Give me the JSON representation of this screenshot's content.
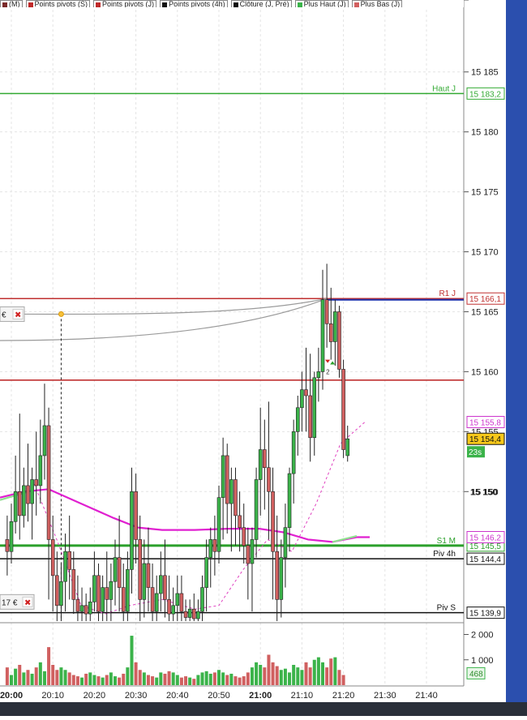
{
  "legend": [
    {
      "label": "(M)",
      "color": "#7a2a2a"
    },
    {
      "label": "Points pivots (S)",
      "color": "#c02a2a"
    },
    {
      "label": "Points pivots (J)",
      "color": "#c02a2a"
    },
    {
      "label": "Points pivots (4h)",
      "color": "#111111"
    },
    {
      "label": "Clôture (J, Pré)",
      "color": "#111111"
    },
    {
      "label": "Plus Haut (J)",
      "color": "#3bb34a"
    },
    {
      "label": "Plus Bas (J)",
      "color": "#d26060"
    }
  ],
  "chart_data": {
    "type": "candlestick",
    "x_ticks": [
      "20:00",
      "20:10",
      "20:20",
      "20:30",
      "20:40",
      "20:50",
      "21:00",
      "21:10",
      "21:20",
      "21:30",
      "21:40"
    ],
    "y_ticks": [
      "15 185",
      "15 180",
      "15 175",
      "15 170",
      "15 165",
      "15 160",
      "15 155",
      "15 150"
    ],
    "ylim": [
      15139.2,
      15191
    ],
    "volume_ticks": [
      "2 000",
      "1 000"
    ],
    "volume_ylim": [
      0,
      2400
    ],
    "candles": [
      {
        "t": "19:59",
        "o": 15146.0,
        "h": 15148.0,
        "c": 15145.0,
        "l": 15143.0
      },
      {
        "t": "20:00",
        "o": 15145.0,
        "h": 15149.0,
        "c": 15147.5,
        "l": 15144.0
      },
      {
        "t": "20:01",
        "o": 15147.5,
        "h": 15153.0,
        "c": 15150.0,
        "l": 15146.5
      },
      {
        "t": "20:02",
        "o": 15150.0,
        "h": 15156.5,
        "c": 15148.0,
        "l": 15146.0
      },
      {
        "t": "20:03",
        "o": 15148.0,
        "h": 15152.0,
        "c": 15150.5,
        "l": 15147.0
      },
      {
        "t": "20:04",
        "o": 15150.5,
        "h": 15154.0,
        "c": 15149.0,
        "l": 15147.5
      },
      {
        "t": "20:05",
        "o": 15149.0,
        "h": 15152.0,
        "c": 15151.0,
        "l": 15146.0
      },
      {
        "t": "20:06",
        "o": 15151.0,
        "h": 15155.0,
        "c": 15150.5,
        "l": 15148.0
      },
      {
        "t": "20:07",
        "o": 15150.5,
        "h": 15156.0,
        "c": 15153.0,
        "l": 15149.0
      },
      {
        "t": "20:08",
        "o": 15153.0,
        "h": 15159.0,
        "c": 15155.5,
        "l": 15151.0
      },
      {
        "t": "20:09",
        "o": 15155.5,
        "h": 15157.0,
        "c": 15146.0,
        "l": 15141.0
      },
      {
        "t": "20:10",
        "o": 15146.0,
        "h": 15148.0,
        "c": 15143.0,
        "l": 15140.0
      },
      {
        "t": "20:11",
        "o": 15143.0,
        "h": 15145.0,
        "c": 15140.5,
        "l": 15139.2
      },
      {
        "t": "20:12",
        "o": 15140.5,
        "h": 15144.0,
        "c": 15142.5,
        "l": 15139.2
      },
      {
        "t": "20:13",
        "o": 15142.5,
        "h": 15146.5,
        "c": 15145.0,
        "l": 15140.0
      },
      {
        "t": "20:14",
        "o": 15145.0,
        "h": 15148.0,
        "c": 15143.5,
        "l": 15141.0
      },
      {
        "t": "20:15",
        "o": 15143.5,
        "h": 15145.0,
        "c": 15141.0,
        "l": 15139.8
      },
      {
        "t": "20:16",
        "o": 15141.0,
        "h": 15143.0,
        "c": 15140.0,
        "l": 15139.2
      },
      {
        "t": "20:17",
        "o": 15140.0,
        "h": 15142.0,
        "c": 15140.5,
        "l": 15139.2
      },
      {
        "t": "20:18",
        "o": 15140.5,
        "h": 15141.5,
        "c": 15139.8,
        "l": 15139.2
      },
      {
        "t": "20:19",
        "o": 15139.8,
        "h": 15142.0,
        "c": 15140.8,
        "l": 15139.2
      },
      {
        "t": "20:20",
        "o": 15140.8,
        "h": 15145.0,
        "c": 15143.0,
        "l": 15140.0
      },
      {
        "t": "20:21",
        "o": 15143.0,
        "h": 15144.0,
        "c": 15140.0,
        "l": 15139.2
      },
      {
        "t": "20:22",
        "o": 15140.0,
        "h": 15143.0,
        "c": 15142.0,
        "l": 15139.2
      },
      {
        "t": "20:23",
        "o": 15142.0,
        "h": 15145.0,
        "c": 15141.0,
        "l": 15139.2
      },
      {
        "t": "20:24",
        "o": 15141.0,
        "h": 15144.0,
        "c": 15142.5,
        "l": 15139.2
      },
      {
        "t": "20:25",
        "o": 15142.5,
        "h": 15146.0,
        "c": 15144.5,
        "l": 15140.5
      },
      {
        "t": "20:26",
        "o": 15144.5,
        "h": 15148.0,
        "c": 15142.0,
        "l": 15140.0
      },
      {
        "t": "20:27",
        "o": 15142.0,
        "h": 15144.0,
        "c": 15140.0,
        "l": 15139.2
      },
      {
        "t": "20:28",
        "o": 15140.0,
        "h": 15145.0,
        "c": 15143.5,
        "l": 15139.2
      },
      {
        "t": "20:29",
        "o": 15143.5,
        "h": 15152.0,
        "c": 15150.0,
        "l": 15141.5
      },
      {
        "t": "20:30",
        "o": 15150.0,
        "h": 15151.5,
        "c": 15146.0,
        "l": 15144.0
      },
      {
        "t": "20:31",
        "o": 15146.0,
        "h": 15148.0,
        "c": 15141.0,
        "l": 15139.2
      },
      {
        "t": "20:32",
        "o": 15141.0,
        "h": 15146.0,
        "c": 15144.0,
        "l": 15139.5
      },
      {
        "t": "20:33",
        "o": 15144.0,
        "h": 15147.0,
        "c": 15142.0,
        "l": 15140.0
      },
      {
        "t": "20:34",
        "o": 15142.0,
        "h": 15144.0,
        "c": 15140.0,
        "l": 15139.2
      },
      {
        "t": "20:35",
        "o": 15140.0,
        "h": 15143.0,
        "c": 15141.5,
        "l": 15139.2
      },
      {
        "t": "20:36",
        "o": 15141.5,
        "h": 15145.0,
        "c": 15143.0,
        "l": 15140.0
      },
      {
        "t": "20:37",
        "o": 15143.0,
        "h": 15146.0,
        "c": 15141.0,
        "l": 15139.5
      },
      {
        "t": "20:38",
        "o": 15141.0,
        "h": 15143.0,
        "c": 15139.8,
        "l": 15139.2
      },
      {
        "t": "20:39",
        "o": 15139.8,
        "h": 15142.0,
        "c": 15140.5,
        "l": 15139.2
      },
      {
        "t": "20:40",
        "o": 15140.5,
        "h": 15143.0,
        "c": 15141.5,
        "l": 15139.2
      },
      {
        "t": "20:41",
        "o": 15141.5,
        "h": 15143.0,
        "c": 15140.0,
        "l": 15139.2
      },
      {
        "t": "20:42",
        "o": 15140.0,
        "h": 15141.0,
        "c": 15139.5,
        "l": 15139.2
      },
      {
        "t": "20:43",
        "o": 15139.5,
        "h": 15141.0,
        "c": 15140.2,
        "l": 15139.2
      },
      {
        "t": "20:44",
        "o": 15140.2,
        "h": 15141.5,
        "c": 15139.4,
        "l": 15139.2
      },
      {
        "t": "20:45",
        "o": 15139.4,
        "h": 15141.0,
        "c": 15140.0,
        "l": 15139.2
      },
      {
        "t": "20:46",
        "o": 15140.0,
        "h": 15143.0,
        "c": 15142.0,
        "l": 15139.2
      },
      {
        "t": "20:47",
        "o": 15142.0,
        "h": 15146.0,
        "c": 15144.5,
        "l": 15140.0
      },
      {
        "t": "20:48",
        "o": 15144.5,
        "h": 15147.0,
        "c": 15146.0,
        "l": 15142.0
      },
      {
        "t": "20:49",
        "o": 15146.0,
        "h": 15148.0,
        "c": 15145.0,
        "l": 15143.0
      },
      {
        "t": "20:50",
        "o": 15145.0,
        "h": 15150.5,
        "c": 15149.5,
        "l": 15144.0
      },
      {
        "t": "20:51",
        "o": 15149.5,
        "h": 15154.5,
        "c": 15153.0,
        "l": 15146.0
      },
      {
        "t": "20:52",
        "o": 15153.0,
        "h": 15154.0,
        "c": 15149.0,
        "l": 15146.5
      },
      {
        "t": "20:53",
        "o": 15149.0,
        "h": 15152.0,
        "c": 15151.0,
        "l": 15145.0
      },
      {
        "t": "20:54",
        "o": 15151.0,
        "h": 15152.0,
        "c": 15148.0,
        "l": 15145.5
      },
      {
        "t": "20:55",
        "o": 15148.0,
        "h": 15150.0,
        "c": 15147.0,
        "l": 15145.0
      },
      {
        "t": "20:56",
        "o": 15147.0,
        "h": 15149.0,
        "c": 15145.5,
        "l": 15144.0
      },
      {
        "t": "20:57",
        "o": 15145.5,
        "h": 15147.0,
        "c": 15144.0,
        "l": 15141.0
      },
      {
        "t": "20:58",
        "o": 15144.0,
        "h": 15147.0,
        "c": 15146.0,
        "l": 15140.0
      },
      {
        "t": "20:59",
        "o": 15146.0,
        "h": 15152.0,
        "c": 15151.0,
        "l": 15144.5
      },
      {
        "t": "21:00",
        "o": 15151.0,
        "h": 15157.0,
        "c": 15153.5,
        "l": 15148.0
      },
      {
        "t": "21:01",
        "o": 15153.5,
        "h": 15156.0,
        "c": 15152.0,
        "l": 15148.5
      },
      {
        "t": "21:02",
        "o": 15152.0,
        "h": 15157.5,
        "c": 15150.0,
        "l": 15146.0
      },
      {
        "t": "21:03",
        "o": 15150.0,
        "h": 15152.0,
        "c": 15145.0,
        "l": 15141.0
      },
      {
        "t": "21:04",
        "o": 15145.0,
        "h": 15148.0,
        "c": 15141.0,
        "l": 15139.2
      },
      {
        "t": "21:05",
        "o": 15141.0,
        "h": 15146.0,
        "c": 15144.5,
        "l": 15139.5
      },
      {
        "t": "21:06",
        "o": 15144.5,
        "h": 15149.0,
        "c": 15147.0,
        "l": 15142.0
      },
      {
        "t": "21:07",
        "o": 15147.0,
        "h": 15152.0,
        "c": 15151.5,
        "l": 15145.0
      },
      {
        "t": "21:08",
        "o": 15151.5,
        "h": 15156.0,
        "c": 15155.0,
        "l": 15149.0
      },
      {
        "t": "21:09",
        "o": 15155.0,
        "h": 15158.0,
        "c": 15157.0,
        "l": 15153.0
      },
      {
        "t": "21:10",
        "o": 15157.0,
        "h": 15160.0,
        "c": 15158.5,
        "l": 15155.0
      },
      {
        "t": "21:11",
        "o": 15158.5,
        "h": 15162.0,
        "c": 15158.0,
        "l": 15155.0
      },
      {
        "t": "21:12",
        "o": 15158.0,
        "h": 15161.5,
        "c": 15154.5,
        "l": 15152.5
      },
      {
        "t": "21:13",
        "o": 15154.5,
        "h": 15160.0,
        "c": 15159.5,
        "l": 15153.0
      },
      {
        "t": "21:14",
        "o": 15159.5,
        "h": 15162.0,
        "c": 15160.0,
        "l": 15157.5
      },
      {
        "t": "21:15",
        "o": 15160.0,
        "h": 15168.5,
        "c": 15166.0,
        "l": 15158.5
      },
      {
        "t": "21:16",
        "o": 15166.0,
        "h": 15169.0,
        "c": 15164.0,
        "l": 15162.0
      },
      {
        "t": "21:17",
        "o": 15164.0,
        "h": 15167.0,
        "c": 15162.5,
        "l": 15161.0
      },
      {
        "t": "21:18",
        "o": 15162.5,
        "h": 15166.0,
        "c": 15165.0,
        "l": 15160.5
      },
      {
        "t": "21:19",
        "o": 15165.0,
        "h": 15165.5,
        "c": 15160.2,
        "l": 15159.5
      },
      {
        "t": "21:20",
        "o": 15160.2,
        "h": 15161.0,
        "c": 15153.5,
        "l": 15152.8
      },
      {
        "t": "21:21",
        "o": 15153.0,
        "h": 15155.5,
        "c": 15154.4,
        "l": 15152.5
      }
    ],
    "volumes": [
      700,
      400,
      650,
      800,
      500,
      600,
      450,
      700,
      900,
      550,
      1500,
      800,
      600,
      700,
      600,
      500,
      400,
      350,
      300,
      450,
      500,
      400,
      350,
      300,
      400,
      500,
      350,
      300,
      450,
      700,
      1950,
      900,
      600,
      500,
      400,
      350,
      300,
      500,
      450,
      550,
      500,
      400,
      300,
      350,
      300,
      250,
      400,
      500,
      550,
      450,
      500,
      600,
      500,
      400,
      450,
      350,
      300,
      350,
      500,
      700,
      900,
      800,
      700,
      1200,
      900,
      750,
      600,
      650,
      500,
      800,
      700,
      600,
      900,
      700,
      1000,
      1100,
      900,
      700,
      1050,
      1100,
      600,
      400
    ],
    "horizontal_lines": [
      {
        "label": "Haut J",
        "value": 15183.2,
        "color": "#33aa33",
        "price_label": "15 183,2"
      },
      {
        "label": "R1 J",
        "value": 15166.1,
        "color": "#c03030",
        "price_label": "15 166,1"
      },
      {
        "label": "",
        "value": 15159.3,
        "color": "#c03030",
        "price_label": ""
      },
      {
        "label": "S1 M",
        "value": 15145.5,
        "color": "#2ba02b",
        "price_label": "15 145,5"
      },
      {
        "label": "Piv 4h",
        "value": 15144.4,
        "color": "#111111",
        "price_label": "15 144,4"
      },
      {
        "label": "Piv S",
        "value": 15139.9,
        "color": "#111111",
        "price_label": "15 139,9"
      }
    ],
    "price_tags": [
      {
        "label": "15 155,8",
        "value": 15155.8,
        "color": "#cc33cc",
        "bg": "#ffffff"
      },
      {
        "label": "15 154,4",
        "value": 15154.4,
        "color": "#111111",
        "bg": "#f7c81a"
      },
      {
        "label": "15 146,2",
        "value": 15146.2,
        "color": "#cc33cc",
        "bg": "#ffffff"
      }
    ],
    "timer_tag": "23s",
    "volume_tag": "468",
    "current_axis_label": "15 150",
    "order_tags": [
      {
        "label": "€",
        "value": 15164.8
      },
      {
        "label": "17 €",
        "value": 15140.8
      }
    ],
    "signal_note": "2"
  },
  "colors": {
    "bull": "#3bb34a",
    "bear": "#d06060",
    "ma_long": "#e020d0",
    "ma_short_dashed": "#e040c0"
  }
}
